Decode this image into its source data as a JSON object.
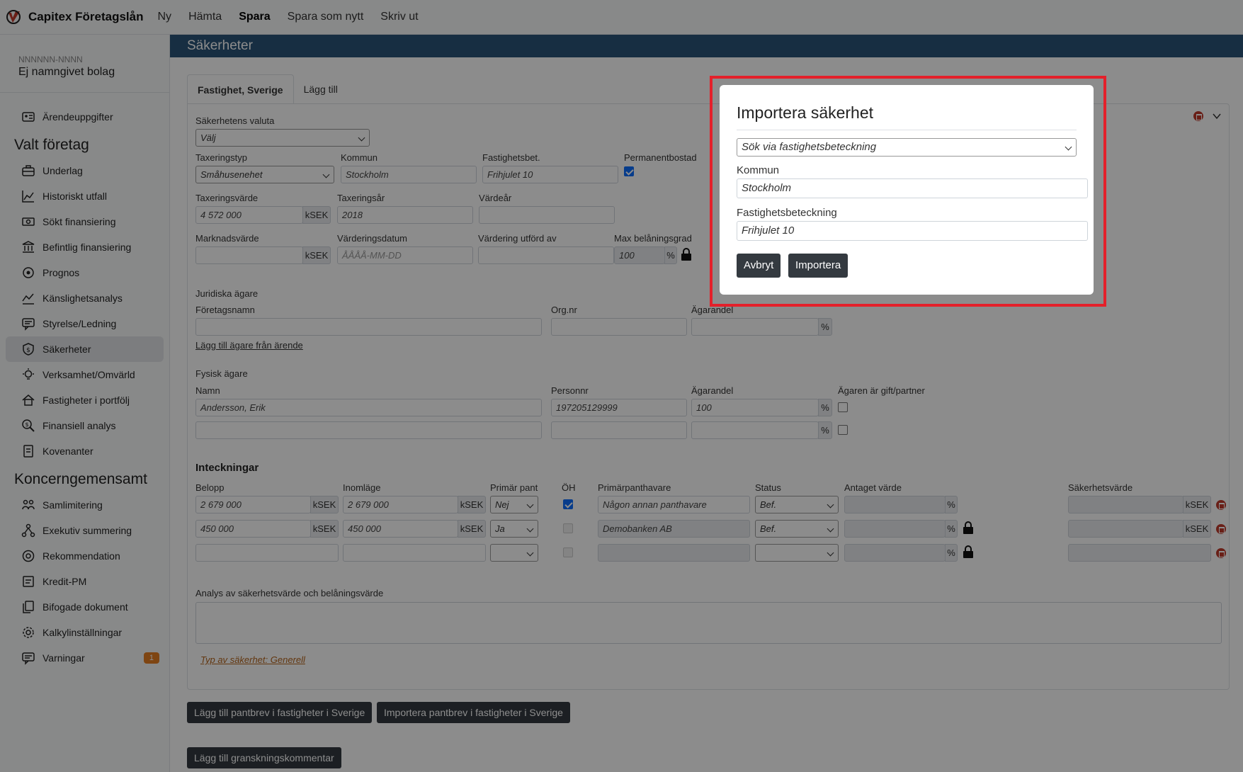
{
  "brand": "Capitex Företagslån",
  "topnav": [
    "Ny",
    "Hämta",
    "Spara",
    "Spara som nytt",
    "Skriv ut"
  ],
  "company": {
    "orgnr": "NNNNNN-NNNN",
    "name": "Ej namngivet bolag"
  },
  "sidebar": {
    "arende": "Ärendeuppgifter",
    "group1": "Valt företag",
    "items1": [
      "Underlag",
      "Historiskt utfall",
      "Sökt finansiering",
      "Befintlig finansiering",
      "Prognos",
      "Känslighetsanalys",
      "Styrelse/Ledning",
      "Säkerheter",
      "Verksamhet/Omvärld",
      "Fastigheter i portfölj",
      "Finansiell analys",
      "Kovenanter"
    ],
    "group2": "Koncerngemensamt",
    "items2": [
      "Samlimitering",
      "Exekutiv summering",
      "Rekommendation",
      "Kredit-PM",
      "Bifogade dokument",
      "Kalkylinställningar",
      "Varningar"
    ],
    "warning_count": "1"
  },
  "section_title": "Säkerheter",
  "tabs": [
    "Fastighet, Sverige",
    "Lägg till"
  ],
  "form": {
    "valuta_label": "Säkerhetens valuta",
    "valuta_value": "Välj",
    "taxeringstyp_label": "Taxeringstyp",
    "taxeringstyp_value": "Småhusenehet",
    "kommun_label": "Kommun",
    "kommun_value": "Stockholm",
    "fastbet_label": "Fastighetsbet.",
    "fastbet_value": "Frihjulet 10",
    "permanent_label": "Permanentbostad",
    "taxvarde_label": "Taxeringsvärde",
    "taxvarde_value": "4 572 000",
    "taxar_label": "Taxeringsår",
    "taxar_value": "2018",
    "vardear_label": "Värdeår",
    "marknad_label": "Marknadsvärde",
    "vardedatum_label": "Värderingsdatum",
    "vardedatum_ph": "ÅÅÅÅ-MM-DD",
    "vardutford_label": "Värdering utförd av",
    "maxbel_label": "Max belåningsgrad",
    "maxbel_value": "100",
    "unit_ksek": "kSEK",
    "unit_pct": "%",
    "jur_head": "Juridiska ägare",
    "foretagsnamn_label": "Företagsnamn",
    "orgnr_label": "Org.nr",
    "agarandel_label": "Ägarandel",
    "add_owner_link": "Lägg till ägare från ärende",
    "fys_head": "Fysisk ägare",
    "namn_label": "Namn",
    "personnr_label": "Personnr",
    "gift_label": "Ägaren är gift/partner",
    "owner_name": "Andersson, Erik",
    "owner_pnr": "197205129999",
    "owner_share": "100",
    "inteck_head": "Inteckningar",
    "belopp_label": "Belopp",
    "inomlage_label": "Inomläge",
    "primar_label": "Primär pant",
    "oh_label": "ÖH",
    "primarhavare_label": "Primärpanthavare",
    "status_label": "Status",
    "antaget_label": "Antaget värde",
    "sakvarde_label": "Säkerhetsvärde",
    "rows": [
      {
        "belopp": "2 679 000",
        "inom": "2 679 000",
        "primar": "Nej",
        "havare": "Någon annan panthavare",
        "status": "Bef."
      },
      {
        "belopp": "450 000",
        "inom": "450 000",
        "primar": "Ja",
        "havare": "Demobanken AB",
        "status": "Bef."
      }
    ],
    "analys_label": "Analys av säkerhetsvärde och belåningsvärde",
    "typ_link": "Typ av säkerhet: Generell"
  },
  "buttons": {
    "add_pantbrev": "Lägg till pantbrev i fastigheter i Sverige",
    "import_pantbrev": "Importera pantbrev i fastigheter i Sverige",
    "add_comment": "Lägg till granskningskommentar"
  },
  "modal": {
    "title": "Importera säkerhet",
    "search_mode": "Sök via fastighetsbeteckning",
    "kommun_label": "Kommun",
    "kommun_value": "Stockholm",
    "fast_label": "Fastighetsbeteckning",
    "fast_value": "Frihjulet 10",
    "cancel": "Avbryt",
    "import": "Importera"
  }
}
